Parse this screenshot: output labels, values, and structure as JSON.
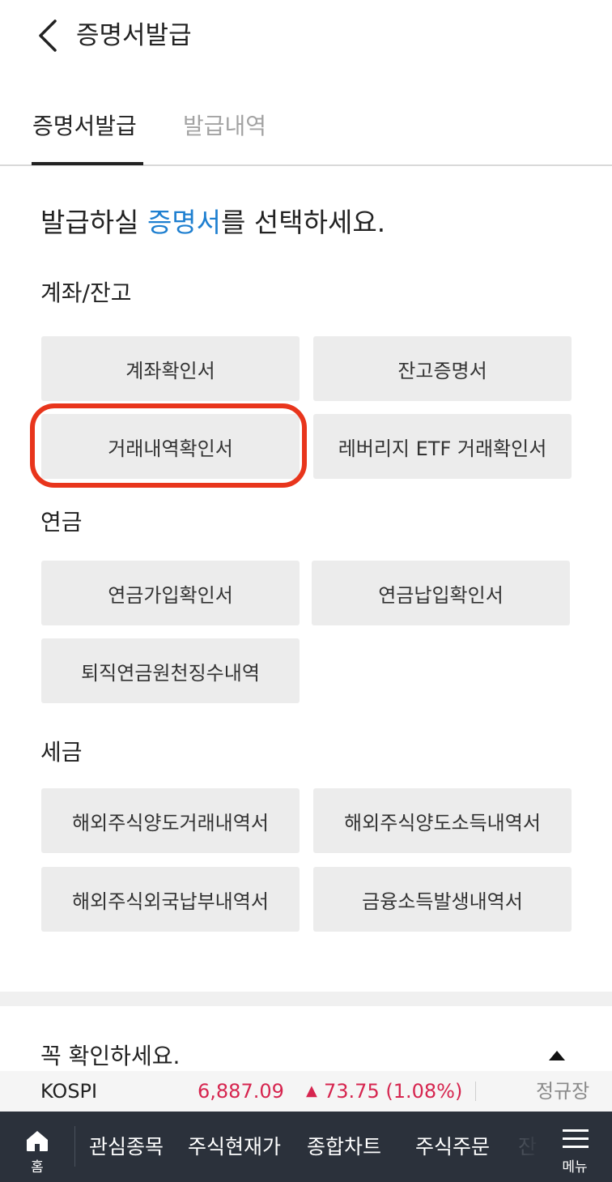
{
  "header": {
    "title": "증명서발급",
    "back_icon": "chevron-left-icon"
  },
  "tabs": [
    {
      "label": "증명서발급",
      "active": true
    },
    {
      "label": "발급내역",
      "active": false
    }
  ],
  "prompt": {
    "before": "발급하실 ",
    "highlight": "증명서",
    "after": "를 선택하세요.",
    "highlight_color": "#1e7fd0"
  },
  "sections": {
    "account": {
      "title": "계좌/잔고",
      "buttons": [
        "계좌확인서",
        "잔고증명서",
        "거래내역확인서",
        "레버리지 ETF 거래확인서"
      ]
    },
    "pension": {
      "title": "연금",
      "buttons": [
        "연금가입확인서",
        "연금납입확인서",
        "퇴직연금원천징수내역"
      ]
    },
    "tax": {
      "title": "세금",
      "buttons": [
        "해외주식양도거래내역서",
        "해외주식양도소득내역서",
        "해외주식외국납부내역서",
        "금융소득발생내역서"
      ]
    }
  },
  "highlight": {
    "target": "거래내역확인서",
    "color": "#e8351c"
  },
  "notice": {
    "title": "꼭 확인하세요.",
    "toggle_icon": "triangle-up-icon"
  },
  "ticker": {
    "name": "KOSPI",
    "value": "6,887.09",
    "direction_icon": "triangle-up-icon",
    "change": "73.75 (1.08%)",
    "session": "정규장",
    "up_color": "#d6254f"
  },
  "bottom_nav": {
    "home": {
      "label": "홈",
      "icon": "home-icon"
    },
    "items": [
      "관심종목",
      "주식현재가",
      "종합차트",
      "주식주문"
    ],
    "partial_item": "잔",
    "menu": {
      "label": "메뉴",
      "icon": "hamburger-icon"
    }
  }
}
